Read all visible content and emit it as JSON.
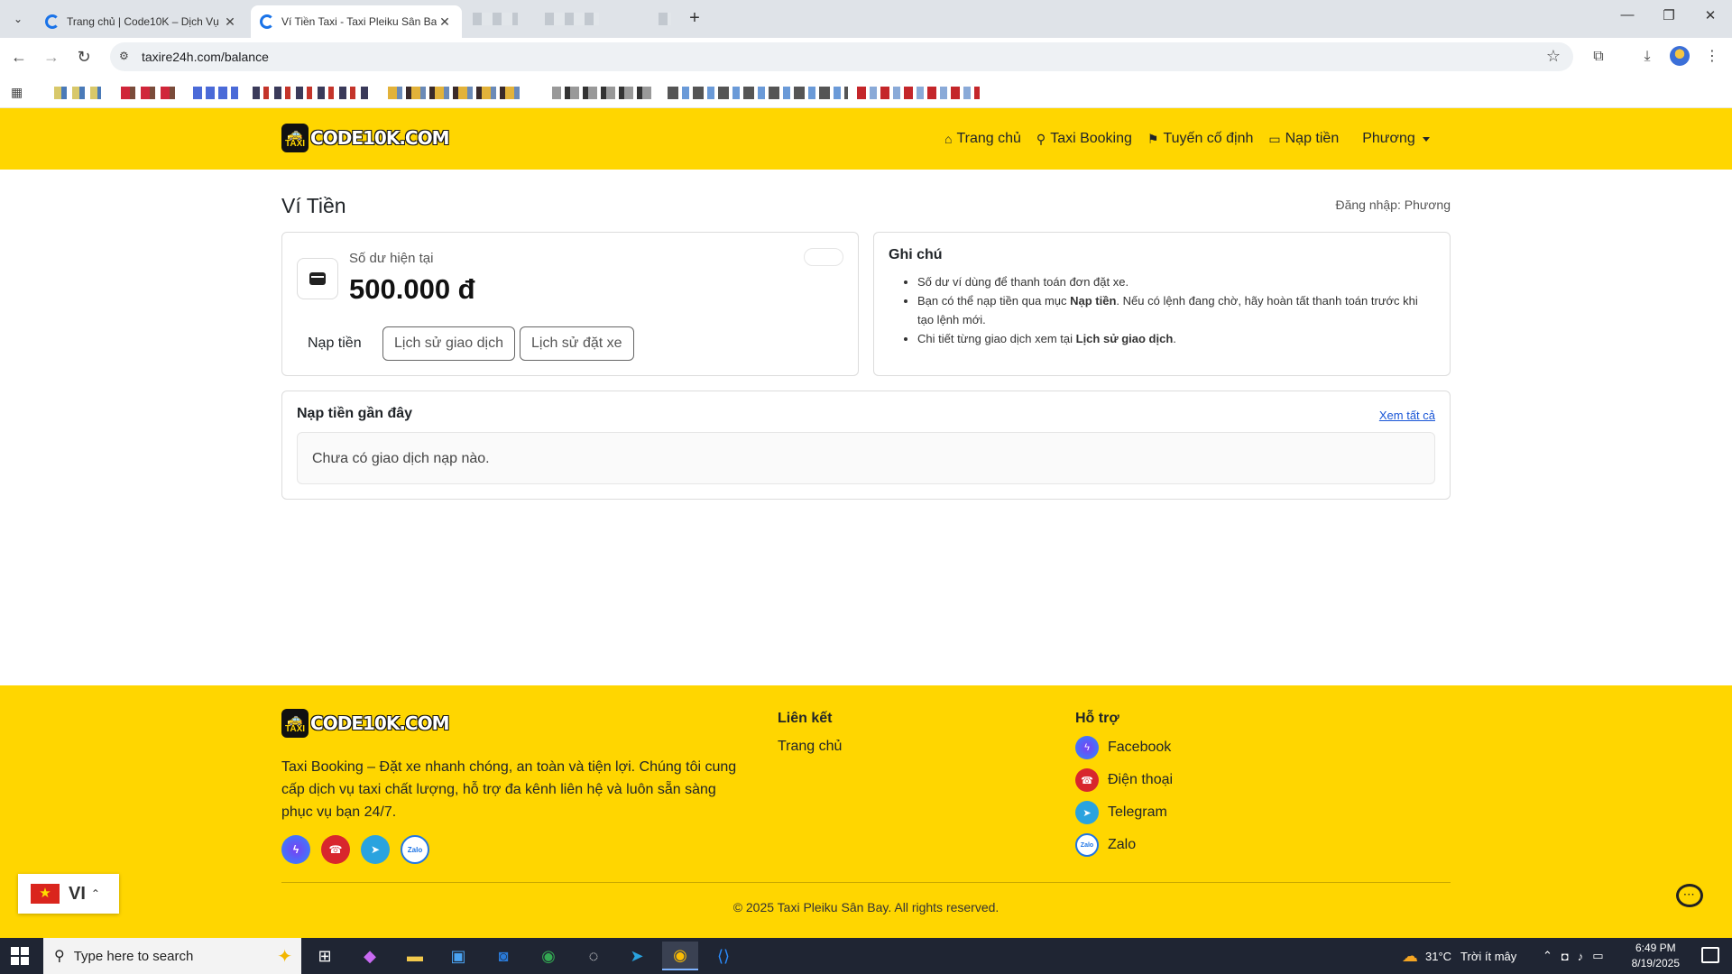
{
  "browser": {
    "tabs": [
      {
        "title": "Trang chủ | Code10K – Dịch Vụ",
        "active": false
      },
      {
        "title": "Ví Tiền Taxi - Taxi Pleiku Sân Bay",
        "active": true
      }
    ],
    "url": "taxire24h.com/balance"
  },
  "header": {
    "logo_text": "CODE10K.COM",
    "logo_badge": "TAXI",
    "nav": [
      {
        "label": "Trang chủ",
        "icon": "home-icon"
      },
      {
        "label": "Taxi Booking",
        "icon": "map-pin-icon"
      },
      {
        "label": "Tuyến cố định",
        "icon": "signpost-icon"
      },
      {
        "label": "Nạp tiền",
        "icon": "wallet-icon"
      },
      {
        "label": "Phương",
        "icon": "chevron-down-icon"
      }
    ]
  },
  "main": {
    "title": "Ví Tiền",
    "login_info": "Đăng nhập: Phương",
    "balance": {
      "label": "Số dư hiện tại",
      "value": "500.000 đ",
      "topup_button": "Nạp tiền",
      "history_button": "Lịch sử giao dịch",
      "booking_history_button": "Lịch sử đặt xe"
    },
    "notes": {
      "title": "Ghi chú",
      "item1": "Số dư ví dùng để thanh toán đơn đặt xe.",
      "item2_pre": "Bạn có thể nạp tiền qua mục ",
      "item2_bold": "Nạp tiền",
      "item2_post": ". Nếu có lệnh đang chờ, hãy hoàn tất thanh toán trước khi tạo lệnh mới.",
      "item3_pre": "Chi tiết từng giao dịch xem tại ",
      "item3_bold": "Lịch sử giao dịch",
      "item3_post": "."
    },
    "recent": {
      "title": "Nạp tiền gần đây",
      "see_all": "Xem tất cả",
      "empty": "Chưa có giao dịch nạp nào."
    }
  },
  "footer": {
    "logo_text": "CODE10K.COM",
    "description": "Taxi Booking – Đặt xe nhanh chóng, an toàn và tiện lợi. Chúng tôi cung cấp dịch vụ taxi chất lượng, hỗ trợ đa kênh liên hệ và luôn sẵn sàng phục vụ bạn 24/7.",
    "links_title": "Liên kết",
    "links": [
      "Trang chủ"
    ],
    "support_title": "Hỗ trợ",
    "support": [
      "Facebook",
      "Điện thoại",
      "Telegram",
      "Zalo"
    ],
    "copyright": "© 2025 Taxi Pleiku Sân Bay. All rights reserved."
  },
  "language": {
    "code": "VI"
  },
  "taskbar": {
    "search_placeholder": "Type here to search",
    "weather": "31°C",
    "weather_text": "Trời ít mây",
    "time": "6:49 PM",
    "date": "8/19/2025"
  },
  "colors": {
    "brand_yellow": "#ffd600",
    "link_blue": "#1a56d6"
  }
}
